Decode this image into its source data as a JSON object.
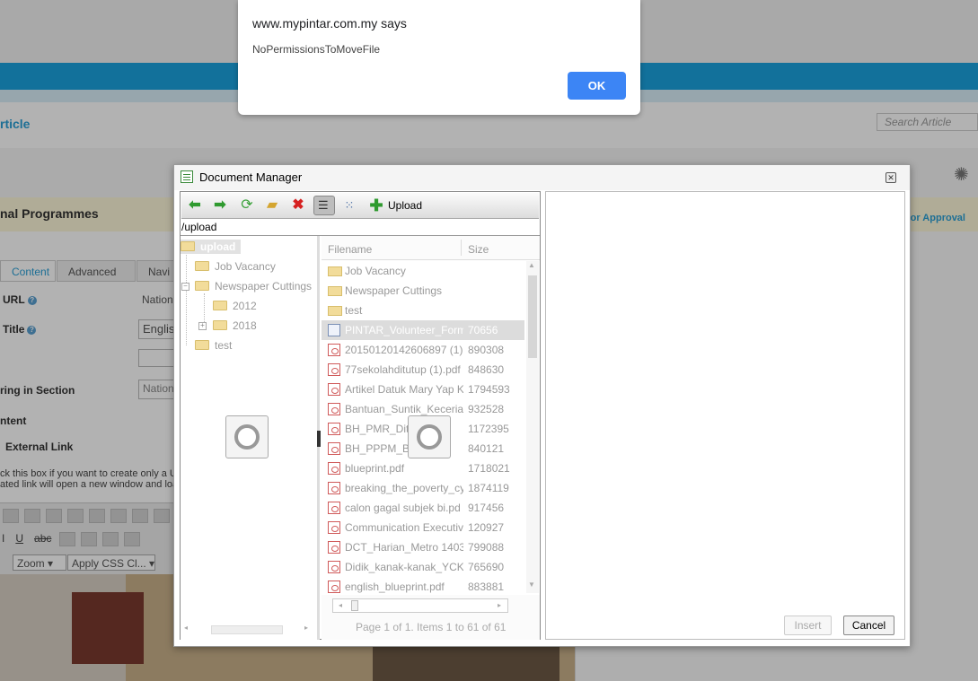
{
  "alert": {
    "title": "www.mypintar.com.my says",
    "message": "NoPermissionsToMoveFile",
    "ok_label": "OK"
  },
  "background": {
    "page_heading": "rticle",
    "search_placeholder": "Search Article",
    "section_title": "nal Programmes",
    "approval_link": "for Approval",
    "tabs": [
      "Content",
      "Advanced",
      "Navi"
    ],
    "url_label": "URL",
    "url_value": "Nationa",
    "title_label": "Title",
    "title_value": "Englis",
    "section_label": "ring in Section",
    "section_value": "Nation",
    "content_label": "ntent",
    "external_link_label": "External Link",
    "hint_line1": "ck this box if you want to create only a U",
    "hint_line2": "ated link will open a new window and load",
    "zoom_label": "Zoom",
    "css_label": "Apply CSS Cl..."
  },
  "doc_manager": {
    "title": "Document Manager",
    "upload_label": "Upload",
    "path": "/upload",
    "tree": {
      "root": "upload",
      "items": [
        "Job Vacancy",
        "Newspaper Cuttings",
        "2012",
        "2018",
        "test"
      ]
    },
    "files": {
      "col_filename": "Filename",
      "col_size": "Size",
      "rows": [
        {
          "name": "Job Vacancy",
          "size": "",
          "type": "folder"
        },
        {
          "name": "Newspaper Cuttings",
          "size": "",
          "type": "folder"
        },
        {
          "name": "test",
          "size": "",
          "type": "folder"
        },
        {
          "name": "PINTAR_Volunteer_Form.",
          "size": "70656",
          "type": "doc"
        },
        {
          "name": "20150120142606897 (1).",
          "size": "890308",
          "type": "pdf"
        },
        {
          "name": "77sekolahditutup (1).pdf",
          "size": "848630",
          "type": "pdf"
        },
        {
          "name": "Artikel Datuk Mary Yap K",
          "size": "1794593",
          "type": "pdf"
        },
        {
          "name": "Bantuan_Suntik_Keceriaa",
          "size": "932528",
          "type": "pdf"
        },
        {
          "name": "BH_PMR_Dita",
          "size": "1172395",
          "type": "pdf"
        },
        {
          "name": "BH_PPPM_Be",
          "size": "840121",
          "type": "pdf"
        },
        {
          "name": "blueprint.pdf",
          "size": "1718021",
          "type": "pdf"
        },
        {
          "name": "breaking_the_poverty_cy",
          "size": "1874119",
          "type": "pdf"
        },
        {
          "name": "calon gagal subjek bi.pd",
          "size": "917456",
          "type": "pdf"
        },
        {
          "name": "Communication Executiv",
          "size": "120927",
          "type": "pdf"
        },
        {
          "name": "DCT_Harian_Metro 1403.",
          "size": "799088",
          "type": "pdf"
        },
        {
          "name": "Didik_kanak-kanak_YCK_",
          "size": "765690",
          "type": "pdf"
        },
        {
          "name": "english_blueprint.pdf",
          "size": "883881",
          "type": "pdf"
        }
      ]
    },
    "pager_text": "Page 1 of 1. Items 1 to 61 of 61",
    "insert_label": "Insert",
    "cancel_label": "Cancel"
  },
  "colors": {
    "alert_ok": "#3c85f5",
    "top_bar": "#1aa3de",
    "accent_link": "#2a9fd6"
  },
  "icons": [
    "back-arrow-icon",
    "forward-arrow-icon",
    "refresh-icon",
    "new-folder-icon",
    "delete-icon",
    "details-view-icon",
    "thumbnails-view-icon",
    "upload-plus-icon",
    "folder-icon",
    "pdf-file-icon",
    "document-icon",
    "loading-spinner-icon",
    "close-icon",
    "help-icon"
  ]
}
